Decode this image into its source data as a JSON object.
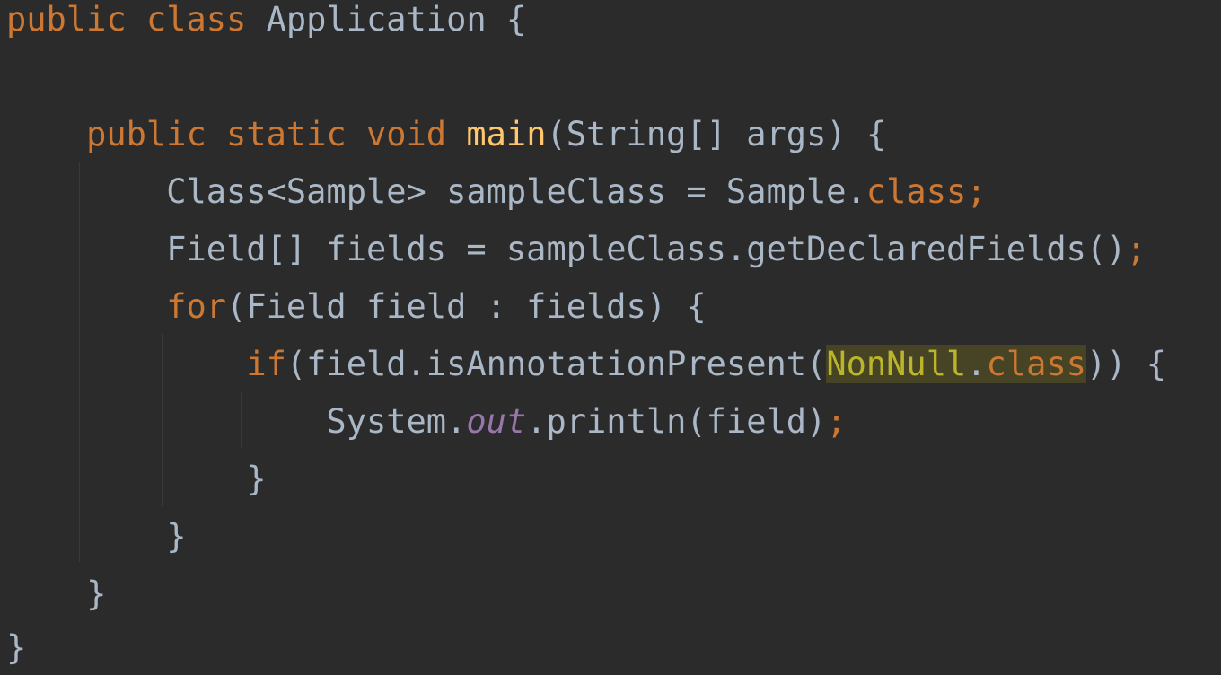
{
  "editor": {
    "language": "Java",
    "theme": "Darcula",
    "colors": {
      "background": "#2b2b2b",
      "text": "#a9b7c6",
      "keyword": "#cc7832",
      "method_declaration": "#ffc66d",
      "static_field": "#9876aa",
      "annotation_reference": "#bbb529",
      "usage_highlight": "#474426"
    },
    "lines": [
      {
        "tokens": [
          {
            "t": "public",
            "k": "keyword"
          },
          {
            "t": " ",
            "k": "ident"
          },
          {
            "t": "class",
            "k": "keyword"
          },
          {
            "t": " Application {",
            "k": "ident"
          }
        ]
      },
      {
        "tokens": []
      },
      {
        "tokens": [
          {
            "t": "    ",
            "k": "ident"
          },
          {
            "t": "public",
            "k": "keyword"
          },
          {
            "t": " ",
            "k": "ident"
          },
          {
            "t": "static",
            "k": "keyword"
          },
          {
            "t": " ",
            "k": "ident"
          },
          {
            "t": "void",
            "k": "keyword"
          },
          {
            "t": " ",
            "k": "ident"
          },
          {
            "t": "main",
            "k": "method"
          },
          {
            "t": "(String[] args) {",
            "k": "ident"
          }
        ]
      },
      {
        "tokens": [
          {
            "t": "        Class<Sample> sampleClass = Sample.",
            "k": "ident"
          },
          {
            "t": "class",
            "k": "keyword"
          },
          {
            "t": ";",
            "k": "semicolon"
          }
        ]
      },
      {
        "tokens": [
          {
            "t": "        Field[] fields = sampleClass.getDeclaredFields()",
            "k": "ident"
          },
          {
            "t": ";",
            "k": "semicolon"
          }
        ]
      },
      {
        "tokens": [
          {
            "t": "        ",
            "k": "ident"
          },
          {
            "t": "for",
            "k": "keyword"
          },
          {
            "t": "(Field field : fields) {",
            "k": "ident"
          }
        ]
      },
      {
        "tokens": [
          {
            "t": "            ",
            "k": "ident"
          },
          {
            "t": "if",
            "k": "keyword"
          },
          {
            "t": "(field.isAnnotationPresent(",
            "k": "ident"
          },
          {
            "t": "NonNull",
            "k": "annot",
            "hl": true
          },
          {
            "t": ".",
            "k": "ident",
            "hl": true
          },
          {
            "t": "class",
            "k": "keyword",
            "hl": true
          },
          {
            "t": ")) {",
            "k": "ident"
          }
        ]
      },
      {
        "tokens": [
          {
            "t": "                System.",
            "k": "ident"
          },
          {
            "t": "out",
            "k": "static"
          },
          {
            "t": ".println(field)",
            "k": "ident"
          },
          {
            "t": ";",
            "k": "semicolon"
          }
        ]
      },
      {
        "tokens": [
          {
            "t": "            }",
            "k": "ident"
          }
        ]
      },
      {
        "tokens": [
          {
            "t": "        }",
            "k": "ident"
          }
        ]
      },
      {
        "tokens": [
          {
            "t": "    }",
            "k": "ident"
          }
        ]
      },
      {
        "tokens": [
          {
            "t": "}",
            "k": "ident"
          }
        ]
      }
    ]
  }
}
